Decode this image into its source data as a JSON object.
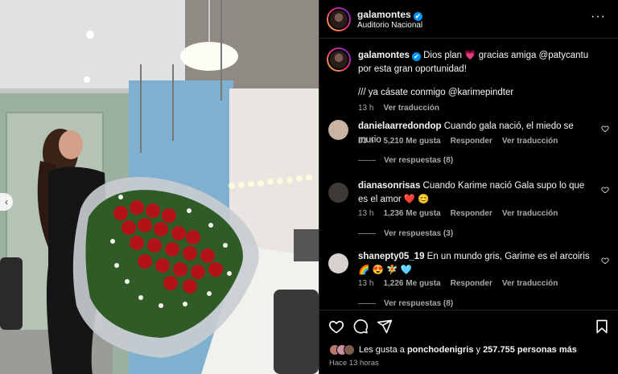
{
  "post": {
    "username": "galamontes",
    "location": "Auditorio Nacional",
    "verified_mark": "✔",
    "more_menu": "···"
  },
  "caption": {
    "username": "galamontes",
    "text_line1": " Dios plan 💗 gracias amiga @patycantu por esta gran oportunidad!",
    "text_line2": "/// ya cásate conmigo @karimepindter",
    "time": "13 h",
    "translate": "Ver traducción"
  },
  "comments": [
    {
      "username": "danielaarredondop",
      "text": " Cuando gala nació, el miedo se murio",
      "time": "13 h",
      "likes": "5,210 Me gusta",
      "reply": "Responder",
      "translate": "Ver traducción",
      "view_replies": "Ver respuestas (8)",
      "avatar_color": "#c9b3a3"
    },
    {
      "username": "dianasonrisas",
      "text": " Cuando Karime nació Gala supo lo que es el amor ❤️ 😊",
      "time": "13 h",
      "likes": "1,236 Me gusta",
      "reply": "Responder",
      "translate": "Ver traducción",
      "view_replies": "Ver respuestas (3)",
      "avatar_color": "#3d3a38"
    },
    {
      "username": "shanepty05_19",
      "text": " En un mundo gris, Garime es el arcoiris🌈 😍 🧚 🩵",
      "time": "13 h",
      "likes": "1,226 Me gusta",
      "reply": "Responder",
      "translate": "Ver traducción",
      "view_replies": "Ver respuestas (8)",
      "avatar_color": "#d8d2cf"
    }
  ],
  "actions": {
    "like_icon": "heart-icon",
    "comment_icon": "comment-icon",
    "share_icon": "share-icon",
    "save_icon": "bookmark-icon"
  },
  "likes": {
    "prefix": "Les gusta a ",
    "user": "ponchodenigris",
    "suffix_join": " y ",
    "count": "257.755 personas más"
  },
  "posted_ago": "Hace 13 horas",
  "photo": {
    "prev_arrow": "‹"
  },
  "colors": {
    "background": "#000000",
    "text": "#f5f5f5",
    "secondary": "#a8a8a8",
    "verified": "#0095f6",
    "divider": "#262626"
  }
}
